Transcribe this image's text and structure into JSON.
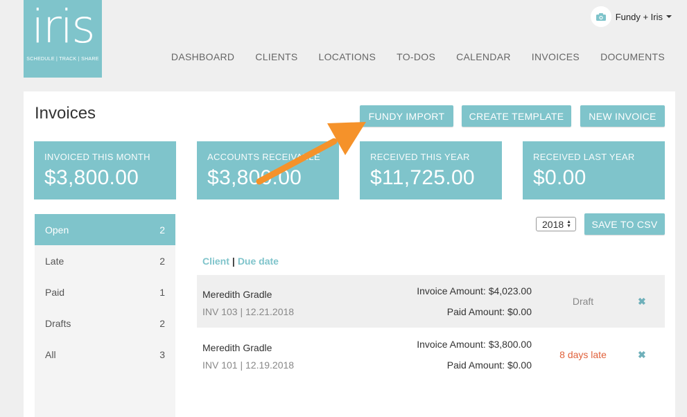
{
  "logo": {
    "word": "iris",
    "tagline": "SCHEDULE | TRACK | SHARE"
  },
  "account": {
    "name": "Fundy + Iris",
    "icon": "camera-icon"
  },
  "nav": [
    "DASHBOARD",
    "CLIENTS",
    "LOCATIONS",
    "TO-DOS",
    "CALENDAR",
    "INVOICES",
    "DOCUMENTS"
  ],
  "page": {
    "title": "Invoices"
  },
  "actions": {
    "fundy_import": "FUNDY IMPORT",
    "create_template": "CREATE TEMPLATE",
    "new_invoice": "NEW INVOICE"
  },
  "stats": [
    {
      "label": "INVOICED THIS MONTH",
      "value": "$3,800.00"
    },
    {
      "label": "ACCOUNTS RECEIVABLE",
      "value": "$3,800.00"
    },
    {
      "label": "RECEIVED THIS YEAR",
      "value": "$11,725.00"
    },
    {
      "label": "RECEIVED LAST YEAR",
      "value": "$0.00"
    }
  ],
  "filters": [
    {
      "label": "Open",
      "count": "2"
    },
    {
      "label": "Late",
      "count": "2"
    },
    {
      "label": "Paid",
      "count": "1"
    },
    {
      "label": "Drafts",
      "count": "2"
    },
    {
      "label": "All",
      "count": "3"
    }
  ],
  "toolbar": {
    "year": "2018",
    "save_csv": "SAVE TO CSV"
  },
  "sort": {
    "client": "Client",
    "separator": "|",
    "due_date": "Due date"
  },
  "invoices": [
    {
      "client": "Meredith Gradle",
      "meta": "INV 103 | 12.21.2018",
      "invoice_amount": "Invoice Amount: $4,023.00",
      "paid_amount": "Paid Amount: $0.00",
      "status": "Draft",
      "status_color": "#888888"
    },
    {
      "client": "Meredith Gradle",
      "meta": "INV 101 | 12.19.2018",
      "invoice_amount": "Invoice Amount: $3,800.00",
      "paid_amount": "Paid Amount: $0.00",
      "status": "8 days late",
      "status_color": "#e0603a"
    }
  ],
  "colors": {
    "accent": "#7fc4cb",
    "arrow": "#f5922a",
    "late": "#e0603a"
  }
}
